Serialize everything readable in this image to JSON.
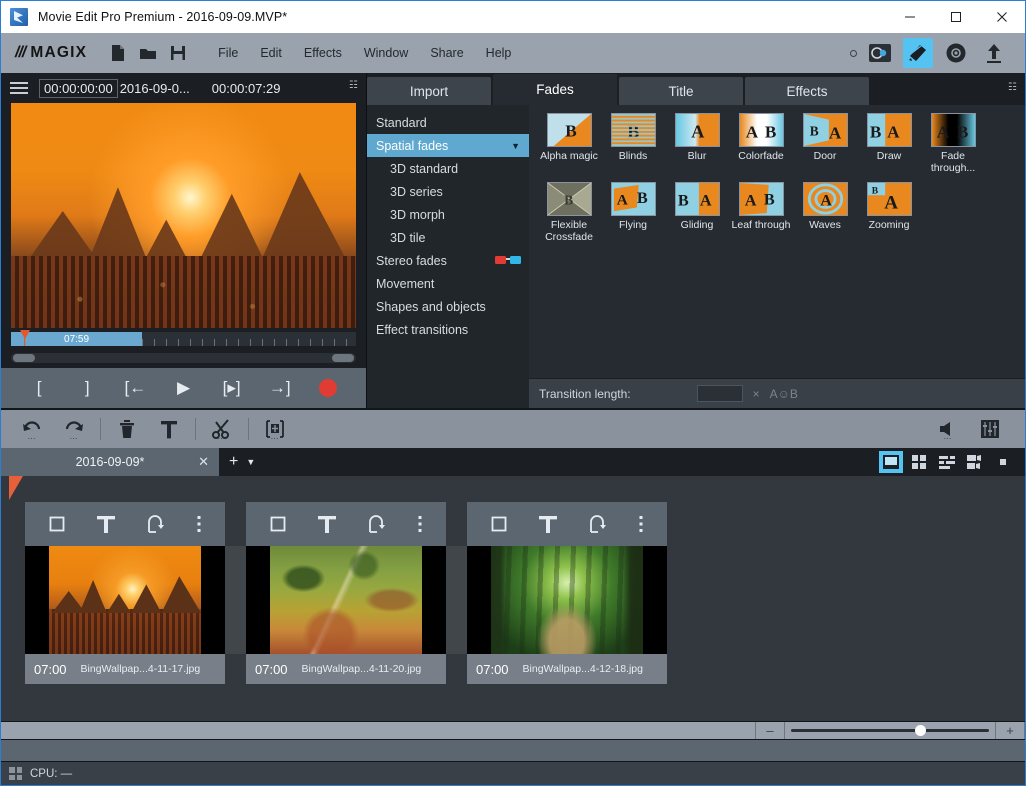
{
  "window": {
    "title": "Movie Edit Pro Premium - 2016-09-09.MVP*",
    "app_icon": "magix-app-icon",
    "buttons": {
      "minimize": "minimize-icon",
      "maximize": "maximize-icon",
      "close": "close-icon"
    }
  },
  "menubar": {
    "brand_slashes": "///",
    "brand_word": "MAGIX",
    "quick_icons": [
      "new-file-icon",
      "open-folder-icon",
      "save-disk-icon"
    ],
    "items": [
      "File",
      "Edit",
      "Effects",
      "Window",
      "Share",
      "Help"
    ],
    "right_icons": [
      "record-dot-icon",
      "capture-icon",
      "edit-mode-icon",
      "burn-disc-icon",
      "export-upload-icon"
    ],
    "selected_right_icon": "edit-mode-icon"
  },
  "monitor": {
    "menu_icon": "hamburger-icon",
    "timecode_current": "00:00:00:00",
    "project_name": "2016-09-0...",
    "timecode_total": "00:00:07:29",
    "expand_icon": "expand-icon",
    "scrub_label": "07:59",
    "controls": [
      {
        "name": "set-in-point-button",
        "glyph": "["
      },
      {
        "name": "set-out-point-button",
        "glyph": "]"
      },
      {
        "name": "jump-to-start-button",
        "glyph": "[←"
      },
      {
        "name": "play-button",
        "glyph": "▶"
      },
      {
        "name": "play-range-button",
        "glyph": "[▸]"
      },
      {
        "name": "jump-to-end-button",
        "glyph": "→]"
      },
      {
        "name": "record-button",
        "glyph": ""
      }
    ]
  },
  "pool": {
    "tabs": [
      {
        "label": "Import",
        "active": false
      },
      {
        "label": "Fades",
        "active": true
      },
      {
        "label": "Title",
        "active": false
      },
      {
        "label": "Effects",
        "active": false
      }
    ],
    "expand_icon": "expand-icon",
    "categories": [
      {
        "label": "Standard",
        "selected": false,
        "sub": false
      },
      {
        "label": "Spatial fades",
        "selected": true,
        "sub": false,
        "caret": "▼"
      },
      {
        "label": "3D standard",
        "selected": false,
        "sub": true
      },
      {
        "label": "3D series",
        "selected": false,
        "sub": true
      },
      {
        "label": "3D morph",
        "selected": false,
        "sub": true
      },
      {
        "label": "3D tile",
        "selected": false,
        "sub": true
      },
      {
        "label": "Stereo fades",
        "selected": false,
        "sub": false,
        "icon": "3d-glasses-icon"
      },
      {
        "label": "Movement",
        "selected": false,
        "sub": false
      },
      {
        "label": "Shapes and objects",
        "selected": false,
        "sub": false
      },
      {
        "label": "Effect transitions",
        "selected": false,
        "sub": false
      }
    ],
    "fades": [
      {
        "label": "Alpha magic",
        "style": "alpha"
      },
      {
        "label": "Blinds",
        "style": "blinds"
      },
      {
        "label": "Blur",
        "style": "blur"
      },
      {
        "label": "Colorfade",
        "style": "colorfade"
      },
      {
        "label": "Door",
        "style": "door"
      },
      {
        "label": "Draw",
        "style": "draw"
      },
      {
        "label": "Fade through...",
        "style": "fadethrough"
      },
      {
        "label": "Flexible Crossfade",
        "style": "flexible"
      },
      {
        "label": "Flying",
        "style": "flying"
      },
      {
        "label": "Gliding",
        "style": "gliding"
      },
      {
        "label": "Leaf through",
        "style": "leaf"
      },
      {
        "label": "Waves",
        "style": "waves"
      },
      {
        "label": "Zooming",
        "style": "zooming"
      }
    ],
    "transition": {
      "label": "Transition length:",
      "value": "",
      "multiply_symbol": "×",
      "ab_symbol": "A☺B"
    }
  },
  "edit_toolbar": {
    "buttons": [
      {
        "name": "undo-button",
        "icon": "undo-icon",
        "has_dots": true
      },
      {
        "name": "redo-button",
        "icon": "redo-icon",
        "has_dots": true
      },
      {
        "name": "delete-button",
        "icon": "trash-icon",
        "has_dots": false
      },
      {
        "name": "title-button",
        "icon": "text-T-icon",
        "has_dots": false
      },
      {
        "name": "cut-button",
        "icon": "scissors-icon",
        "has_dots": true
      },
      {
        "name": "add-object-button",
        "icon": "add-frame-icon",
        "has_dots": true
      }
    ],
    "right_buttons": [
      {
        "name": "audio-mixer-button",
        "icon": "speaker-icon",
        "has_dots": true
      },
      {
        "name": "mixer-faders-button",
        "icon": "faders-icon",
        "has_dots": false
      }
    ]
  },
  "project_tabs": {
    "tab_label": "2016-09-09*",
    "close_icon": "close-icon",
    "add_icon": "plus-icon",
    "dropdown_icon": "chevron-down-icon",
    "view_buttons": [
      {
        "name": "storyboard-view-button",
        "icon": "single-frame-icon",
        "selected": true
      },
      {
        "name": "grid-view-button",
        "icon": "grid-icon",
        "selected": false
      },
      {
        "name": "scene-overview-button",
        "icon": "list-icon",
        "selected": false
      },
      {
        "name": "timeline-view-button",
        "icon": "multicam-icon",
        "selected": false
      },
      {
        "name": "fullscreen-button",
        "icon": "square-icon",
        "selected": false
      }
    ]
  },
  "storyboard": {
    "marker_icon": "playhead-marker-icon",
    "clip_buttons": [
      {
        "name": "clip-effects-button",
        "icon": "square-icon"
      },
      {
        "name": "clip-title-button",
        "icon": "text-T-icon"
      },
      {
        "name": "clip-rotate-button",
        "icon": "rotate-icon"
      },
      {
        "name": "clip-menu-button",
        "icon": "kebab-menu-icon"
      }
    ],
    "clips": [
      {
        "duration": "07:00",
        "filename": "BingWallpap...4-11-17.jpg",
        "image": "img-a"
      },
      {
        "duration": "07:00",
        "filename": "BingWallpap...4-11-20.jpg",
        "image": "img-b"
      },
      {
        "duration": "07:00",
        "filename": "BingWallpap...4-12-18.jpg",
        "image": "img-c"
      }
    ]
  },
  "bottom": {
    "zoom_out_label": "–",
    "zoom_in_label": "+",
    "zoom_position_percent": 62
  },
  "statusbar": {
    "cpu_icon": "cpu-grid-icon",
    "cpu_text": "CPU: —"
  }
}
